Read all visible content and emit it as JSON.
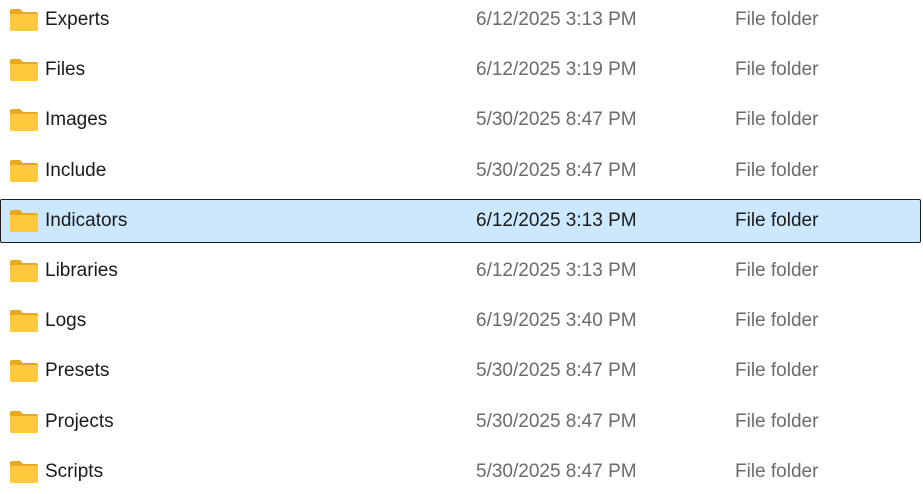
{
  "colors": {
    "selection_bg": "#cce8ff",
    "folder_yellow": "#ffc83d",
    "folder_back": "#e8a820",
    "secondary_text": "#6b6b6b"
  },
  "files": [
    {
      "name": "Experts",
      "date": "6/12/2025 3:13 PM",
      "type": "File folder",
      "icon": "folder-icon",
      "selected": false
    },
    {
      "name": "Files",
      "date": "6/12/2025 3:19 PM",
      "type": "File folder",
      "icon": "folder-icon",
      "selected": false
    },
    {
      "name": "Images",
      "date": "5/30/2025 8:47 PM",
      "type": "File folder",
      "icon": "folder-icon",
      "selected": false
    },
    {
      "name": "Include",
      "date": "5/30/2025 8:47 PM",
      "type": "File folder",
      "icon": "folder-icon",
      "selected": false
    },
    {
      "name": "Indicators",
      "date": "6/12/2025 3:13 PM",
      "type": "File folder",
      "icon": "folder-icon",
      "selected": true
    },
    {
      "name": "Libraries",
      "date": "6/12/2025 3:13 PM",
      "type": "File folder",
      "icon": "folder-icon",
      "selected": false
    },
    {
      "name": "Logs",
      "date": "6/19/2025 3:40 PM",
      "type": "File folder",
      "icon": "folder-icon",
      "selected": false
    },
    {
      "name": "Presets",
      "date": "5/30/2025 8:47 PM",
      "type": "File folder",
      "icon": "folder-icon",
      "selected": false
    },
    {
      "name": "Projects",
      "date": "5/30/2025 8:47 PM",
      "type": "File folder",
      "icon": "folder-icon",
      "selected": false
    },
    {
      "name": "Scripts",
      "date": "5/30/2025 8:47 PM",
      "type": "File folder",
      "icon": "folder-icon",
      "selected": false
    }
  ]
}
